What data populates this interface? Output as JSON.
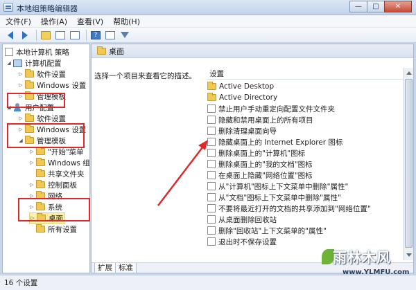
{
  "window": {
    "title": "本地组策略编辑器",
    "controls": {
      "minimize": "—",
      "maximize": "□",
      "close": "✕"
    }
  },
  "menu": {
    "items": [
      "文件(F)",
      "操作(A)",
      "查看(V)",
      "帮助(H)"
    ]
  },
  "toolbar": {
    "icons": [
      "back-arrow-icon",
      "forward-arrow-icon",
      "up-folder-icon",
      "show-hide-tree-icon",
      "export-icon",
      "help-icon",
      "properties-icon",
      "filter-icon"
    ]
  },
  "tree": {
    "items": [
      {
        "label": "本地计算机 策略",
        "icon": "policy-doc-icon"
      },
      {
        "label": "计算机配置",
        "icon": "computer-icon"
      },
      {
        "label": "软件设置",
        "icon": "folder-icon"
      },
      {
        "label": "Windows 设置",
        "icon": "folder-icon"
      },
      {
        "label": "管理模板",
        "icon": "folder-icon"
      },
      {
        "label": "用户配置",
        "icon": "user-icon"
      },
      {
        "label": "软件设置",
        "icon": "folder-icon"
      },
      {
        "label": "Windows 设置",
        "icon": "folder-icon"
      },
      {
        "label": "管理模板",
        "icon": "folder-icon"
      },
      {
        "label": "\"开始\"菜单",
        "icon": "folder-icon"
      },
      {
        "label": "Windows 组件",
        "icon": "folder-icon"
      },
      {
        "label": "共享文件夹",
        "icon": "folder-icon"
      },
      {
        "label": "控制面板",
        "icon": "folder-icon"
      },
      {
        "label": "网络",
        "icon": "folder-icon"
      },
      {
        "label": "系统",
        "icon": "folder-icon"
      },
      {
        "label": "桌面",
        "icon": "folder-icon",
        "selected": true
      },
      {
        "label": "所有设置",
        "icon": "folder-icon"
      }
    ]
  },
  "right": {
    "header_title": "桌面",
    "description": "选择一个项目来查看它的描述。",
    "column_header": "设置",
    "items": [
      {
        "label": "Active Desktop",
        "type": "folder"
      },
      {
        "label": "Active Directory",
        "type": "folder"
      },
      {
        "label": "禁止用户手动重定向配置文件文件夹",
        "type": "setting"
      },
      {
        "label": "隐藏和禁用桌面上的所有项目",
        "type": "setting"
      },
      {
        "label": "删除清理桌面向导",
        "type": "setting"
      },
      {
        "label": "隐藏桌面上的 Internet Explorer 图标",
        "type": "setting"
      },
      {
        "label": "删除桌面上的\"计算机\"图标",
        "type": "setting"
      },
      {
        "label": "删除桌面上的\"我的文档\"图标",
        "type": "setting"
      },
      {
        "label": "在桌面上隐藏\"网络位置\"图标",
        "type": "setting"
      },
      {
        "label": "从\"计算机\"图标上下文菜单中删除\"属性\"",
        "type": "setting"
      },
      {
        "label": "从\"文档\"图标上下文菜单中删除\"属性\"",
        "type": "setting"
      },
      {
        "label": "不要将最近打开的文档的共享添加到\"网络位置\"",
        "type": "setting"
      },
      {
        "label": "从桌面删除回收站",
        "type": "setting"
      },
      {
        "label": "删除\"回收站\"上下文菜单的\"属性\"",
        "type": "setting"
      },
      {
        "label": "退出时不保存设置",
        "type": "setting"
      }
    ],
    "tabs": [
      "扩展",
      "标准"
    ]
  },
  "status": {
    "text": "16 个设置"
  },
  "watermark": {
    "title": "雨林木风",
    "url": "www.YLMFU.com"
  },
  "colors": {
    "annotation_red": "#e0282a",
    "selection": "#fdf0a8"
  }
}
